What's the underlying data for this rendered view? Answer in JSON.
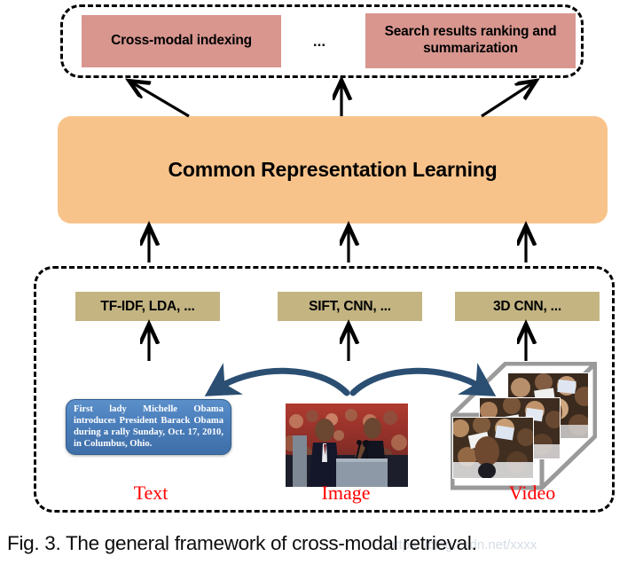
{
  "figure": {
    "caption": "Fig. 3.  The general framework of cross-modal retrieval.",
    "watermark": "https://blog.csdn.net/xxxx"
  },
  "applications": {
    "container_name": "application-layer",
    "boxes": [
      {
        "label": "Cross-modal indexing"
      },
      {
        "label": "Search results ranking and summarization"
      }
    ],
    "ellipsis": "...",
    "box_color": "#d8968f"
  },
  "common_layer": {
    "label": "Common Representation Learning",
    "color": "#f8c38a"
  },
  "features": {
    "boxes": [
      {
        "label": "TF-IDF, LDA, ..."
      },
      {
        "label": "SIFT, CNN, ..."
      },
      {
        "label": "3D CNN, ..."
      }
    ],
    "box_color": "#c3b482"
  },
  "modalities": {
    "text": {
      "label": "Text",
      "content": "First lady Michelle Obama introduces President Barack Obama during a rally Sunday, Oct. 17, 2010, in Columbus, Ohio.",
      "bubble_color": "#4a7ebb"
    },
    "image": {
      "label": "Image",
      "alt": "Photograph of Barack Obama and Michelle Obama standing at a podium before a crowd"
    },
    "video": {
      "label": "Video",
      "alt": "Stack of three video frames showing Barack Obama greeting a crowd holding signs"
    },
    "label_color": "#ff0000"
  },
  "arrows": {
    "color": "#000000",
    "curved_color": "#2b4f72"
  }
}
